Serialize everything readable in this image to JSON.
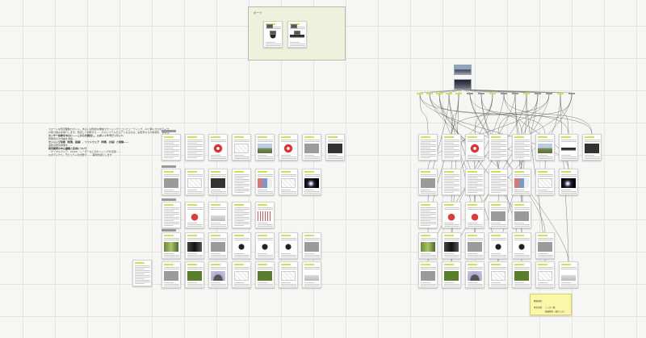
{
  "board": {
    "frame_title": "ボード",
    "notes": [
      {
        "text": "スマートな知覚駆動ロボット、あるいは知的な機械でセンシングとコンピューティング、AIと繋いだロボティクスとアプリケーションの研究を中心に",
        "bold": false
      },
      {
        "text": "の取り組みを紹介します。知覚して判断する……そのシステムのコアとなるのは、実世界からの情報を、信頼性よく取得する事……",
        "bold": false
      },
      {
        "text": "センサー技術を中心に——これらを統合し、ロボットやモビリティへ",
        "bold": true
      },
      {
        "text": "知能化の方法論を考察……",
        "bold": false
      },
      {
        "text": "センシング技術（知覚、認識）、ソフトウェア（判断、計画）と制御……",
        "bold": true
      },
      {
        "text": "最新の研究成果を……",
        "bold": false
      },
      {
        "text": "研究開発の中心課題と応用について",
        "bold": true
      },
      {
        "text": "…サーマルカメラ、LiDAR、レーダーなどのセンシングを活用……",
        "bold": false
      },
      {
        "text": "ロボティクス、モビリティの分野で…… 事例を紹介します",
        "bold": false
      }
    ],
    "labels": [
      {
        "text": "…",
        "interactable": false
      },
      {
        "text": "…",
        "interactable": false
      }
    ],
    "sticky": {
      "lines": [
        "関連項目",
        "参考文献",
        "リンク一覧",
        "関連資料・論文リスト"
      ]
    }
  }
}
